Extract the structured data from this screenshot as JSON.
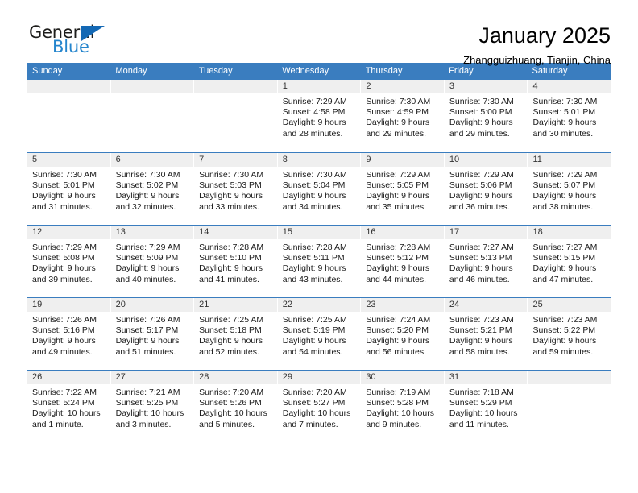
{
  "brand": {
    "name_part1": "General",
    "name_part2": "Blue",
    "triangle_color": "#1368b4",
    "blue_text_color": "#2585cd"
  },
  "header": {
    "title": "January 2025",
    "subtitle": "Zhangguizhuang, Tianjin, China"
  },
  "theme": {
    "header_blue": "#3a7dbf",
    "daynum_band": "#efefef"
  },
  "weekdays": [
    "Sunday",
    "Monday",
    "Tuesday",
    "Wednesday",
    "Thursday",
    "Friday",
    "Saturday"
  ],
  "weeks": [
    [
      {
        "empty": true
      },
      {
        "empty": true
      },
      {
        "empty": true
      },
      {
        "day": "1",
        "sunrise": "Sunrise: 7:29 AM",
        "sunset": "Sunset: 4:58 PM",
        "daylight1": "Daylight: 9 hours",
        "daylight2": "and 28 minutes."
      },
      {
        "day": "2",
        "sunrise": "Sunrise: 7:30 AM",
        "sunset": "Sunset: 4:59 PM",
        "daylight1": "Daylight: 9 hours",
        "daylight2": "and 29 minutes."
      },
      {
        "day": "3",
        "sunrise": "Sunrise: 7:30 AM",
        "sunset": "Sunset: 5:00 PM",
        "daylight1": "Daylight: 9 hours",
        "daylight2": "and 29 minutes."
      },
      {
        "day": "4",
        "sunrise": "Sunrise: 7:30 AM",
        "sunset": "Sunset: 5:01 PM",
        "daylight1": "Daylight: 9 hours",
        "daylight2": "and 30 minutes."
      }
    ],
    [
      {
        "day": "5",
        "sunrise": "Sunrise: 7:30 AM",
        "sunset": "Sunset: 5:01 PM",
        "daylight1": "Daylight: 9 hours",
        "daylight2": "and 31 minutes."
      },
      {
        "day": "6",
        "sunrise": "Sunrise: 7:30 AM",
        "sunset": "Sunset: 5:02 PM",
        "daylight1": "Daylight: 9 hours",
        "daylight2": "and 32 minutes."
      },
      {
        "day": "7",
        "sunrise": "Sunrise: 7:30 AM",
        "sunset": "Sunset: 5:03 PM",
        "daylight1": "Daylight: 9 hours",
        "daylight2": "and 33 minutes."
      },
      {
        "day": "8",
        "sunrise": "Sunrise: 7:30 AM",
        "sunset": "Sunset: 5:04 PM",
        "daylight1": "Daylight: 9 hours",
        "daylight2": "and 34 minutes."
      },
      {
        "day": "9",
        "sunrise": "Sunrise: 7:29 AM",
        "sunset": "Sunset: 5:05 PM",
        "daylight1": "Daylight: 9 hours",
        "daylight2": "and 35 minutes."
      },
      {
        "day": "10",
        "sunrise": "Sunrise: 7:29 AM",
        "sunset": "Sunset: 5:06 PM",
        "daylight1": "Daylight: 9 hours",
        "daylight2": "and 36 minutes."
      },
      {
        "day": "11",
        "sunrise": "Sunrise: 7:29 AM",
        "sunset": "Sunset: 5:07 PM",
        "daylight1": "Daylight: 9 hours",
        "daylight2": "and 38 minutes."
      }
    ],
    [
      {
        "day": "12",
        "sunrise": "Sunrise: 7:29 AM",
        "sunset": "Sunset: 5:08 PM",
        "daylight1": "Daylight: 9 hours",
        "daylight2": "and 39 minutes."
      },
      {
        "day": "13",
        "sunrise": "Sunrise: 7:29 AM",
        "sunset": "Sunset: 5:09 PM",
        "daylight1": "Daylight: 9 hours",
        "daylight2": "and 40 minutes."
      },
      {
        "day": "14",
        "sunrise": "Sunrise: 7:28 AM",
        "sunset": "Sunset: 5:10 PM",
        "daylight1": "Daylight: 9 hours",
        "daylight2": "and 41 minutes."
      },
      {
        "day": "15",
        "sunrise": "Sunrise: 7:28 AM",
        "sunset": "Sunset: 5:11 PM",
        "daylight1": "Daylight: 9 hours",
        "daylight2": "and 43 minutes."
      },
      {
        "day": "16",
        "sunrise": "Sunrise: 7:28 AM",
        "sunset": "Sunset: 5:12 PM",
        "daylight1": "Daylight: 9 hours",
        "daylight2": "and 44 minutes."
      },
      {
        "day": "17",
        "sunrise": "Sunrise: 7:27 AM",
        "sunset": "Sunset: 5:13 PM",
        "daylight1": "Daylight: 9 hours",
        "daylight2": "and 46 minutes."
      },
      {
        "day": "18",
        "sunrise": "Sunrise: 7:27 AM",
        "sunset": "Sunset: 5:15 PM",
        "daylight1": "Daylight: 9 hours",
        "daylight2": "and 47 minutes."
      }
    ],
    [
      {
        "day": "19",
        "sunrise": "Sunrise: 7:26 AM",
        "sunset": "Sunset: 5:16 PM",
        "daylight1": "Daylight: 9 hours",
        "daylight2": "and 49 minutes."
      },
      {
        "day": "20",
        "sunrise": "Sunrise: 7:26 AM",
        "sunset": "Sunset: 5:17 PM",
        "daylight1": "Daylight: 9 hours",
        "daylight2": "and 51 minutes."
      },
      {
        "day": "21",
        "sunrise": "Sunrise: 7:25 AM",
        "sunset": "Sunset: 5:18 PM",
        "daylight1": "Daylight: 9 hours",
        "daylight2": "and 52 minutes."
      },
      {
        "day": "22",
        "sunrise": "Sunrise: 7:25 AM",
        "sunset": "Sunset: 5:19 PM",
        "daylight1": "Daylight: 9 hours",
        "daylight2": "and 54 minutes."
      },
      {
        "day": "23",
        "sunrise": "Sunrise: 7:24 AM",
        "sunset": "Sunset: 5:20 PM",
        "daylight1": "Daylight: 9 hours",
        "daylight2": "and 56 minutes."
      },
      {
        "day": "24",
        "sunrise": "Sunrise: 7:23 AM",
        "sunset": "Sunset: 5:21 PM",
        "daylight1": "Daylight: 9 hours",
        "daylight2": "and 58 minutes."
      },
      {
        "day": "25",
        "sunrise": "Sunrise: 7:23 AM",
        "sunset": "Sunset: 5:22 PM",
        "daylight1": "Daylight: 9 hours",
        "daylight2": "and 59 minutes."
      }
    ],
    [
      {
        "day": "26",
        "sunrise": "Sunrise: 7:22 AM",
        "sunset": "Sunset: 5:24 PM",
        "daylight1": "Daylight: 10 hours",
        "daylight2": "and 1 minute."
      },
      {
        "day": "27",
        "sunrise": "Sunrise: 7:21 AM",
        "sunset": "Sunset: 5:25 PM",
        "daylight1": "Daylight: 10 hours",
        "daylight2": "and 3 minutes."
      },
      {
        "day": "28",
        "sunrise": "Sunrise: 7:20 AM",
        "sunset": "Sunset: 5:26 PM",
        "daylight1": "Daylight: 10 hours",
        "daylight2": "and 5 minutes."
      },
      {
        "day": "29",
        "sunrise": "Sunrise: 7:20 AM",
        "sunset": "Sunset: 5:27 PM",
        "daylight1": "Daylight: 10 hours",
        "daylight2": "and 7 minutes."
      },
      {
        "day": "30",
        "sunrise": "Sunrise: 7:19 AM",
        "sunset": "Sunset: 5:28 PM",
        "daylight1": "Daylight: 10 hours",
        "daylight2": "and 9 minutes."
      },
      {
        "day": "31",
        "sunrise": "Sunrise: 7:18 AM",
        "sunset": "Sunset: 5:29 PM",
        "daylight1": "Daylight: 10 hours",
        "daylight2": "and 11 minutes."
      },
      {
        "empty": true
      }
    ]
  ]
}
